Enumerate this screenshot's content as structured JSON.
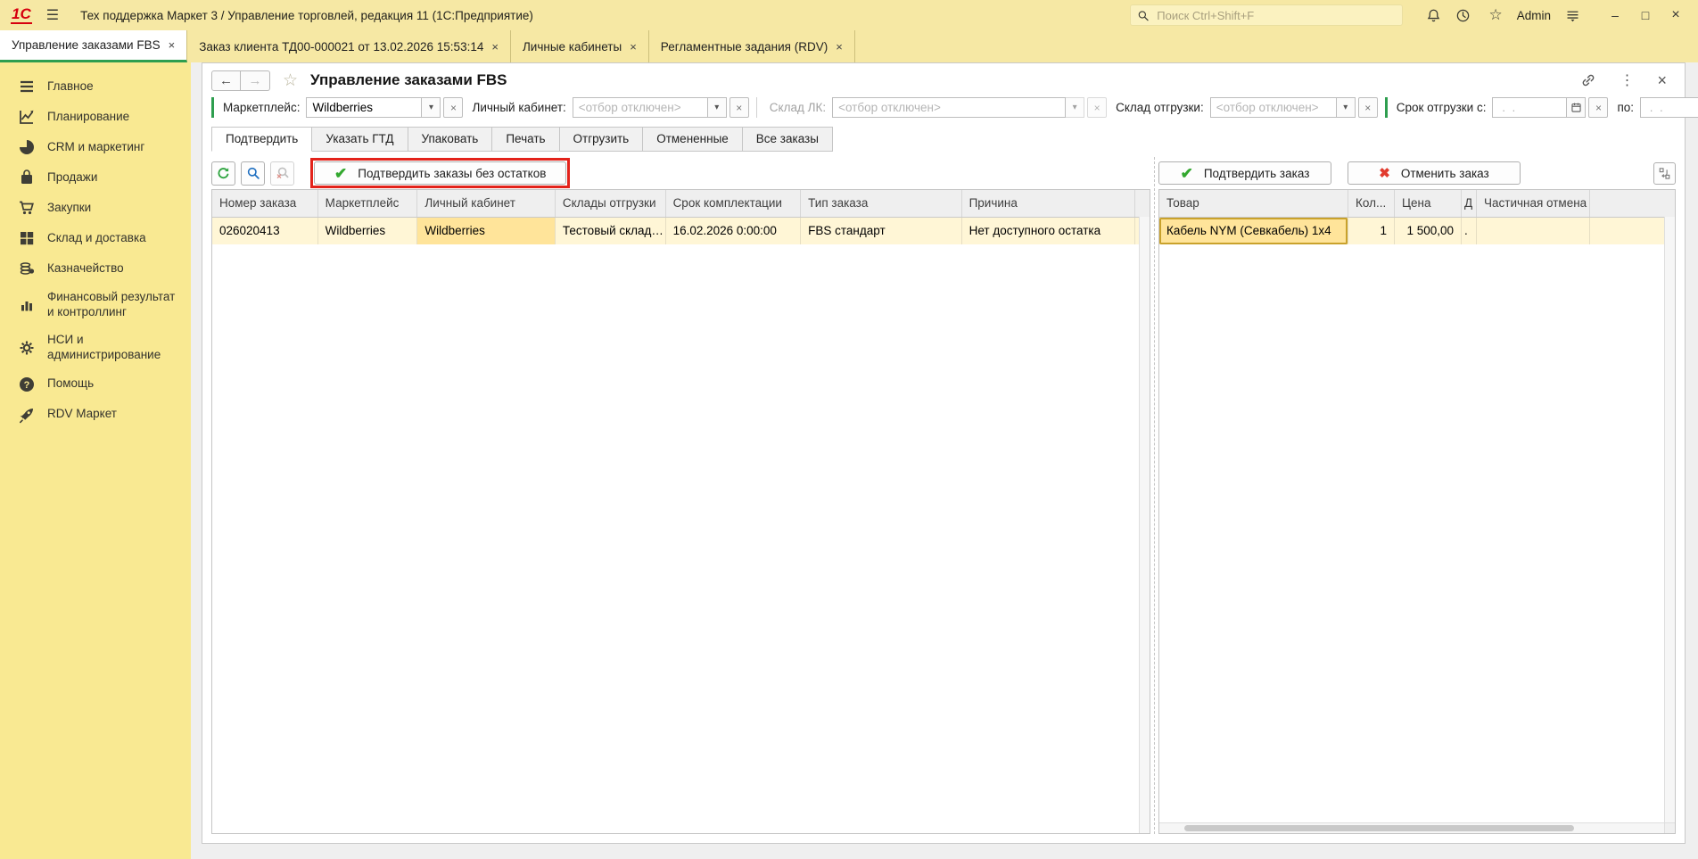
{
  "colors": {
    "titlebar_bg": "#F6E8A4",
    "sidebar_bg": "#F9E992",
    "accent_green": "#2E9E4F",
    "confirm_green": "#33A82F",
    "cancel_red": "#E23B2E",
    "highlight_frame_red": "#E3231B",
    "selected_row_bg": "#FFF6D6",
    "selected_cell_bg": "#FFE49A",
    "selected_cell_border": "#C9A22C"
  },
  "icons": {
    "hamburger": "☰",
    "close": "×",
    "dropdown": "▾",
    "star_outline": "☆",
    "more_vertical": "⋮",
    "back_arrow": "←",
    "forward_arrow": "→",
    "check": "✔",
    "cross": "✖",
    "minimize": "–",
    "maximize": "□"
  },
  "titlebar": {
    "logo": "1С",
    "app_title": "Тех поддержка Маркет 3 / Управление торговлей, редакция 11  (1С:Предприятие)",
    "search_placeholder": "Поиск Ctrl+Shift+F",
    "user": "Admin"
  },
  "window_tabs": [
    {
      "label": "Управление заказами FBS",
      "active": true
    },
    {
      "label": "Заказ клиента ТД00-000021 от 13.02.2026 15:53:14",
      "active": false
    },
    {
      "label": "Личные кабинеты",
      "active": false
    },
    {
      "label": "Регламентные задания (RDV)",
      "active": false
    }
  ],
  "sidebar": {
    "items": [
      {
        "label": "Главное",
        "icon": "menu-icon"
      },
      {
        "label": "Планирование",
        "icon": "planning-icon"
      },
      {
        "label": "CRM и маркетинг",
        "icon": "crm-icon"
      },
      {
        "label": "Продажи",
        "icon": "sales-icon"
      },
      {
        "label": "Закупки",
        "icon": "purchases-icon"
      },
      {
        "label": "Склад и доставка",
        "icon": "warehouse-icon"
      },
      {
        "label": "Казначейство",
        "icon": "treasury-icon"
      },
      {
        "label": "Финансовый результат и контроллинг",
        "icon": "finance-icon"
      },
      {
        "label": "НСИ и администрирование",
        "icon": "settings-icon"
      },
      {
        "label": "Помощь",
        "icon": "help-icon"
      },
      {
        "label": "RDV Маркет",
        "icon": "rocket-icon"
      }
    ]
  },
  "page": {
    "title": "Управление заказами FBS"
  },
  "filters": {
    "marketplace": {
      "label": "Маркетплейс:",
      "value": "Wildberries"
    },
    "cabinet": {
      "label": "Личный кабинет:",
      "placeholder": "<отбор отключен>"
    },
    "warehouse_lk": {
      "label": "Склад ЛК:",
      "placeholder": "<отбор отключен>"
    },
    "warehouse_ship": {
      "label": "Склад отгрузки:",
      "placeholder": "<отбор отключен>"
    },
    "ship_date_from": {
      "label": "Срок отгрузки с:",
      "placeholder": " .  ."
    },
    "ship_date_to": {
      "label": "по:",
      "placeholder": " .  ."
    }
  },
  "view_tabs": [
    "Подтвердить",
    "Указать ГТД",
    "Упаковать",
    "Печать",
    "Отгрузить",
    "Отмененные",
    "Все заказы"
  ],
  "orders_toolbar": {
    "confirm_no_stock": "Подтвердить заказы без остатков"
  },
  "items_toolbar": {
    "confirm": "Подтвердить заказ",
    "cancel": "Отменить заказ"
  },
  "orders_table": {
    "columns": [
      "Номер заказа",
      "Маркетплейс",
      "Личный кабинет",
      "Склады отгрузки",
      "Срок комплектации",
      "Тип заказа",
      "Причина"
    ],
    "rows": [
      [
        "026020413",
        "Wildberries",
        "Wildberries",
        "Тестовый склад…",
        "16.02.2026 0:00:00",
        "FBS стандарт",
        "Нет доступного остатка"
      ]
    ]
  },
  "items_table": {
    "columns": [
      "Товар",
      "Кол...",
      "Цена",
      "Д",
      "Частичная отмена"
    ],
    "rows": [
      [
        "Кабель NYM (Севкабель) 1x4",
        "1",
        "1 500,00",
        ".",
        ""
      ]
    ]
  }
}
